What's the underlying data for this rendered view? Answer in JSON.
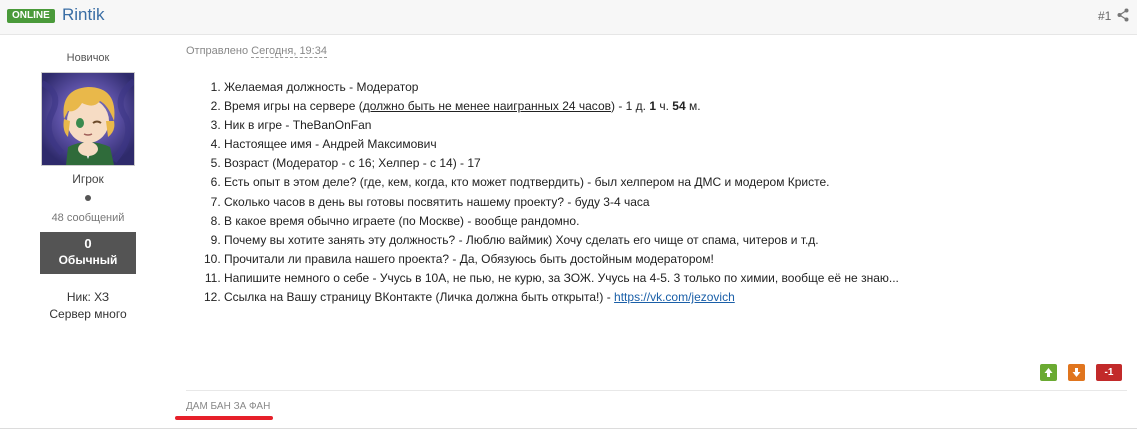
{
  "header": {
    "online_badge": "ONLINE",
    "author": "Rintik",
    "post_number": "#1",
    "share_icon": "share-icon"
  },
  "sidebar": {
    "rank_title": "Новичок",
    "avatar_icon": "anime-avatar",
    "group": "Игрок",
    "post_count": "48 сообщений",
    "reputation_value": "0",
    "reputation_label": "Обычный",
    "field_nick": "Ник: ХЗ",
    "field_server": "Сервер много"
  },
  "post": {
    "posted_prefix": "Отправлено ",
    "posted_date": "Сегодня, 19:34",
    "items": [
      {
        "text": "Желаемая должность - Модератор"
      },
      {
        "a": "Время игры на сервере (",
        "u": "должно быть не менее наигранных 24 часов",
        "b": ") -  1 д. ",
        "c": "1",
        "d": " ч. ",
        "e": "54",
        "f": " м."
      },
      {
        "text": "Ник в игре - TheBanOnFan"
      },
      {
        "text": "Настоящее имя - Андрей Максимович"
      },
      {
        "text": "Возраст  (Модератор - с 16; Хелпер - с 14) - 17"
      },
      {
        "text": "Есть опыт в этом деле? (где, кем, когда, кто может подтвердить) - был хелпером на ДМС и модером Кристе."
      },
      {
        "text": "Сколько часов в день вы готовы посвятить нашему проекту? - буду 3-4 часа"
      },
      {
        "text": "В какое время обычно играете (по Москве) - вообще рандомно."
      },
      {
        "text": "Почему вы хотите занять эту должность? - Люблю ваймик) Хочу сделать его чище от спама, читеров и т.д."
      },
      {
        "text": "Прочитали ли правила нашего проекта? - Да, Обязуюсь быть достойным модератором!"
      },
      {
        "text": "Напишите немного о себе - Учусь в 10А, не пью, не курю, за ЗОЖ. Учусь на 4-5. 3 только по химии, вообще её не знаю..."
      },
      {
        "text": "Ссылка на Вашу страницу ВКонтакте (Личка должна быть открыта!) - ",
        "link": "https://vk.com/jezovich"
      }
    ]
  },
  "votes": {
    "up_icon": "arrow-up-icon",
    "down_icon": "arrow-down-icon",
    "score": "-1"
  },
  "signature": "ДАМ БАН ЗА ФАН",
  "colors": {
    "online": "#4a9a3a",
    "author": "#3a6ea5",
    "vote_up": "#6aaa32",
    "vote_down": "#e0751e",
    "vote_score": "#c22a2a",
    "signature_underline": "#e6202a"
  }
}
